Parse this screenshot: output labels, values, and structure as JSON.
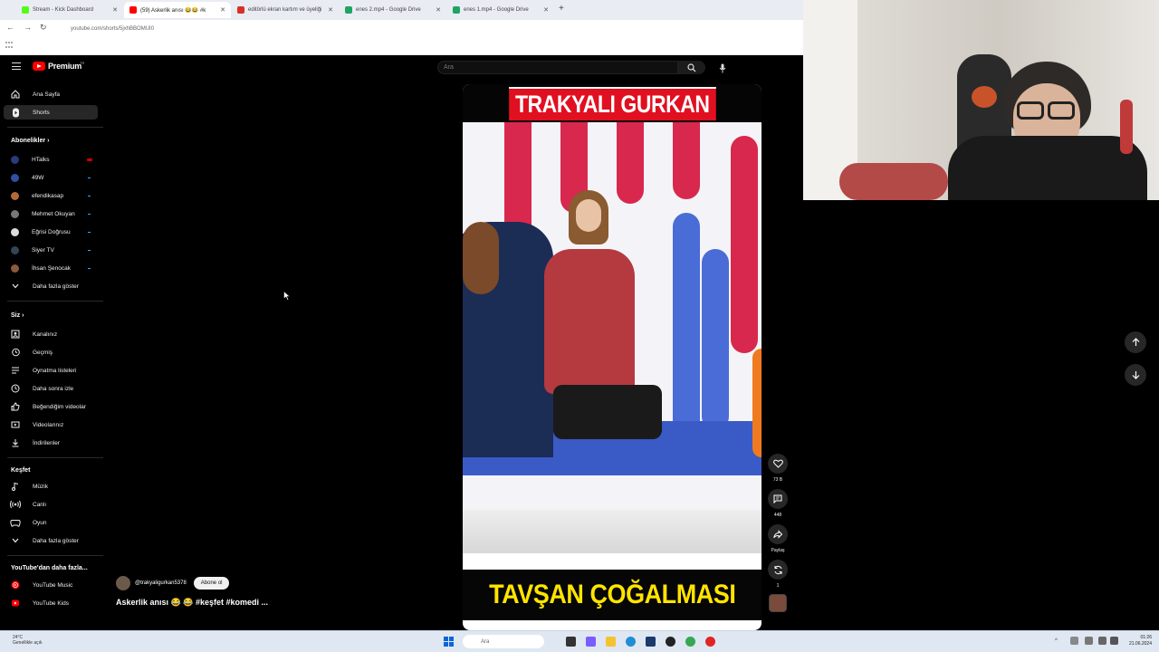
{
  "browser": {
    "tabs": [
      {
        "label": "Stream - Kick Dashboard",
        "favicon_color": "#53fc18"
      },
      {
        "label": "(59) Askerlik anısı 😂😂 #k",
        "favicon_color": "#ff0000"
      },
      {
        "label": "editörlü ekran kartım ve üyeliği",
        "favicon_color": "#d93025"
      },
      {
        "label": "enes 2.mp4 - Google Drive",
        "favicon_color": "#1fa463"
      },
      {
        "label": "enes 1.mp4 - Google Drive",
        "favicon_color": "#1fa463"
      }
    ],
    "new_tab": "+",
    "url": "youtube.com/shorts/5jxhBBOMUI0"
  },
  "masthead": {
    "logo_text": "Premium",
    "logo_region": "TR",
    "search_placeholder": "Ara"
  },
  "sidebar": {
    "main": [
      {
        "label": "Ana Sayfa",
        "icon": "home-icon",
        "active": false
      },
      {
        "label": "Shorts",
        "icon": "shorts-icon",
        "active": true
      }
    ],
    "subs_heading": "Abonelikler",
    "subs": [
      {
        "label": "HTalks",
        "avatar": "#2a3b7a",
        "live": true
      },
      {
        "label": "49W",
        "avatar": "#3050a0",
        "live": false
      },
      {
        "label": "efendikasap",
        "avatar": "#b06a3a",
        "live": false
      },
      {
        "label": "Mehmet Okuyan",
        "avatar": "#777777",
        "live": false
      },
      {
        "label": "Eğrisi Doğrusu",
        "avatar": "#dddddd",
        "live": false
      },
      {
        "label": "Siyer TV",
        "avatar": "#334455",
        "live": false
      },
      {
        "label": "İhsan Şenocak",
        "avatar": "#8a5a3a",
        "live": false
      }
    ],
    "subs_more": "Daha fazla göster",
    "you_heading": "Siz",
    "you": [
      {
        "label": "Kanalınız",
        "icon": "channel-icon"
      },
      {
        "label": "Geçmiş",
        "icon": "history-icon"
      },
      {
        "label": "Oynatma listeleri",
        "icon": "playlists-icon"
      },
      {
        "label": "Daha sonra izle",
        "icon": "watch-later-icon"
      },
      {
        "label": "Beğendiğim videolar",
        "icon": "liked-icon"
      },
      {
        "label": "Videolarınız",
        "icon": "your-videos-icon"
      },
      {
        "label": "İndirilenler",
        "icon": "downloads-icon"
      }
    ],
    "explore_heading": "Keşfet",
    "explore": [
      {
        "label": "Müzik",
        "icon": "music-icon"
      },
      {
        "label": "Canlı",
        "icon": "live-icon"
      },
      {
        "label": "Oyun",
        "icon": "gaming-icon"
      }
    ],
    "explore_more": "Daha fazla göster",
    "more_heading": "YouTube'dan daha fazla...",
    "more": [
      {
        "label": "YouTube Music",
        "icon": "youtube-music-icon"
      },
      {
        "label": "YouTube Kids",
        "icon": "youtube-kids-icon"
      }
    ]
  },
  "short": {
    "top_banner": "TRAKYALI GURKAN",
    "bottom_banner": "TAVŞAN ÇOĞALMASI",
    "channel": "@trakyaligurkan5378",
    "subscribe_label": "Abone ol",
    "caption": "Askerlik anısı 😂 😂 #keşfet #komedi ...",
    "likes": "73 B",
    "comments": "448",
    "share_label": "Paylaş",
    "remix_count": "1"
  },
  "taskbar": {
    "weather_temp": "24°C",
    "weather_desc": "Genellikle açık",
    "search_placeholder": "Ara",
    "time": "01:26",
    "date": "21.06.2024"
  },
  "colors": {
    "brand": "#ff0000",
    "top_banner": "#e01020",
    "bottom_banner_text": "#ffe400"
  }
}
